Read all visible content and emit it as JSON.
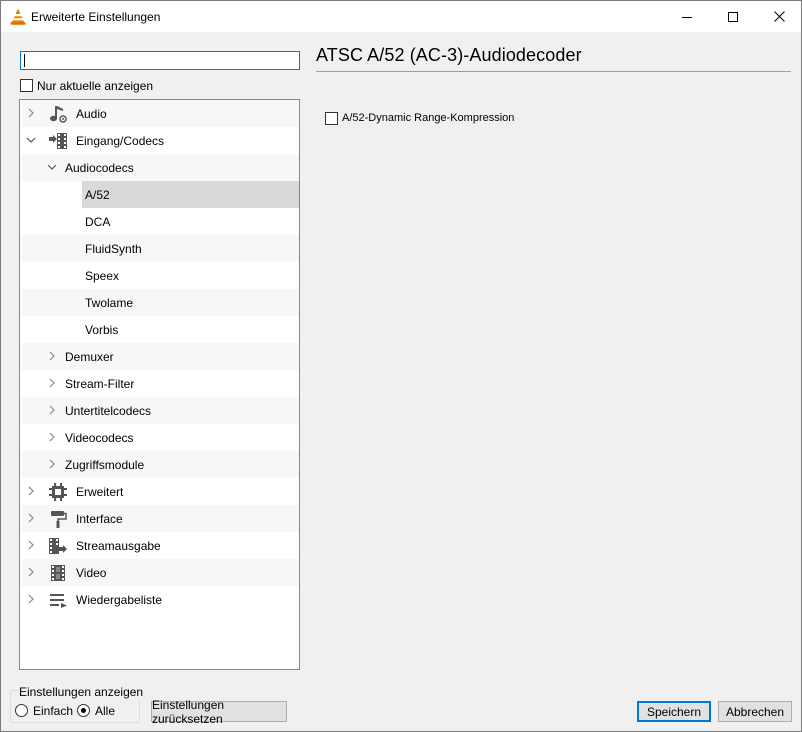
{
  "window": {
    "title": "Erweiterte Einstellungen"
  },
  "search": {
    "value": "",
    "placeholder": ""
  },
  "filter": {
    "only_current_label": "Nur aktuelle anzeigen",
    "checked": false
  },
  "tree": {
    "items": [
      {
        "label": "Audio",
        "icon": "music-note-icon",
        "expanded": false
      },
      {
        "label": "Eingang/Codecs",
        "icon": "codec-film-icon",
        "expanded": true
      },
      {
        "label": "Audiocodecs",
        "expanded": true
      },
      {
        "label": "A/52",
        "selected": true
      },
      {
        "label": "DCA"
      },
      {
        "label": "FluidSynth"
      },
      {
        "label": "Speex"
      },
      {
        "label": "Twolame"
      },
      {
        "label": "Vorbis"
      },
      {
        "label": "Demuxer",
        "expanded": false
      },
      {
        "label": "Stream-Filter",
        "expanded": false
      },
      {
        "label": "Untertitelcodecs",
        "expanded": false
      },
      {
        "label": "Videocodecs",
        "expanded": false
      },
      {
        "label": "Zugriffsmodule",
        "expanded": false
      },
      {
        "label": "Erweitert",
        "icon": "chip-icon",
        "expanded": false
      },
      {
        "label": "Interface",
        "icon": "paint-roller-icon",
        "expanded": false
      },
      {
        "label": "Streamausgabe",
        "icon": "stream-output-icon",
        "expanded": false
      },
      {
        "label": "Video",
        "icon": "film-icon",
        "expanded": false
      },
      {
        "label": "Wiedergabeliste",
        "icon": "playlist-icon",
        "expanded": false
      }
    ]
  },
  "panel": {
    "heading": "ATSC A/52 (AC-3)-Audiodecoder",
    "options": [
      {
        "label": "A/52-Dynamic Range-Kompression",
        "checked": false
      }
    ]
  },
  "show_settings": {
    "legend": "Einstellungen anzeigen",
    "simple_label": "Einfach",
    "all_label": "Alle",
    "selected": "Alle"
  },
  "buttons": {
    "reset": "Einstellungen zurücksetzen",
    "save": "Speichern",
    "cancel": "Abbrechen"
  },
  "colors": {
    "accent": "#0078d7",
    "selection": "#d9d9d9",
    "vlc_orange": "#f08000"
  }
}
